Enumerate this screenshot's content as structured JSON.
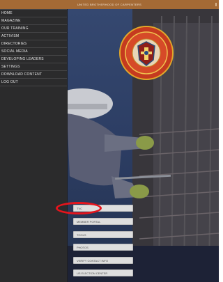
{
  "header": {
    "title": "UNITED BROTHERHOOD OF CARPENTERS"
  },
  "sidebar": {
    "items": [
      {
        "label": "HOME"
      },
      {
        "label": "MAGAZINE"
      },
      {
        "label": "OUR TRAINING"
      },
      {
        "label": "ACTIVISM"
      },
      {
        "label": "DIRECTORIES"
      },
      {
        "label": "SOCIAL MEDIA"
      },
      {
        "label": "DEVELOPING LEADERS"
      },
      {
        "label": "SETTINGS"
      },
      {
        "label": "DOWNLOAD CONTENT"
      },
      {
        "label": "LOG OUT"
      }
    ]
  },
  "main": {
    "buttons": [
      {
        "label": "TVC"
      },
      {
        "label": "MEMBER PORTAL"
      },
      {
        "label": "TOOLS"
      },
      {
        "label": "PHOTOS"
      },
      {
        "label": "VERIFY CONTACT INFO"
      },
      {
        "label": "US ELECTION CENTER"
      }
    ]
  },
  "colors": {
    "topbar": "#a46a35",
    "sidebar": "#2b2b2c",
    "button_bg": "#dedede",
    "highlight": "#e6141c"
  }
}
